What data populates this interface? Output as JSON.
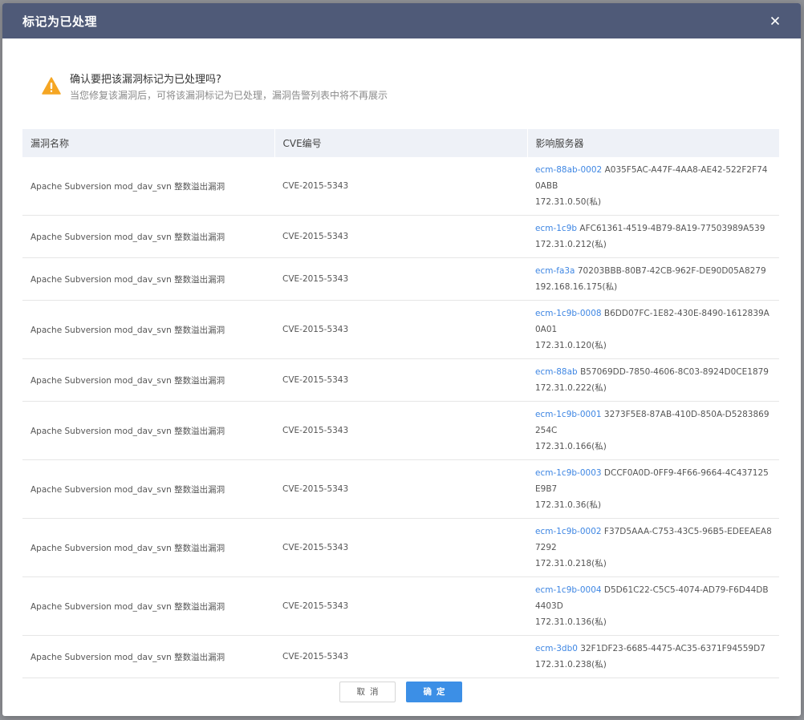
{
  "modal": {
    "title": "标记为已处理",
    "close_icon": "close-icon"
  },
  "notice": {
    "icon": "warning-triangle-icon",
    "icon_color": "#f5a623",
    "title": "确认要把该漏洞标记为已处理吗?",
    "description": "当您修复该漏洞后，可将该漏洞标记为已处理，漏洞告警列表中将不再展示"
  },
  "table": {
    "headers": [
      "漏洞名称",
      "CVE编号",
      "影响服务器"
    ],
    "rows": [
      {
        "name": "Apache Subversion mod_dav_svn 整数溢出漏洞",
        "cve": "CVE-2015-5343",
        "server_name": "ecm-88ab-0002",
        "server_id": "A035F5AC-A47F-4AA8-AE42-522F2F740ABB",
        "ip": "172.31.0.50(私)"
      },
      {
        "name": "Apache Subversion mod_dav_svn 整数溢出漏洞",
        "cve": "CVE-2015-5343",
        "server_name": "ecm-1c9b",
        "server_id": "AFC61361-4519-4B79-8A19-77503989A539",
        "ip": "172.31.0.212(私)"
      },
      {
        "name": "Apache Subversion mod_dav_svn 整数溢出漏洞",
        "cve": "CVE-2015-5343",
        "server_name": "ecm-fa3a",
        "server_id": "70203BBB-80B7-42CB-962F-DE90D05A8279",
        "ip": "192.168.16.175(私)"
      },
      {
        "name": "Apache Subversion mod_dav_svn 整数溢出漏洞",
        "cve": "CVE-2015-5343",
        "server_name": "ecm-1c9b-0008",
        "server_id": "B6DD07FC-1E82-430E-8490-1612839A0A01",
        "ip": "172.31.0.120(私)"
      },
      {
        "name": "Apache Subversion mod_dav_svn 整数溢出漏洞",
        "cve": "CVE-2015-5343",
        "server_name": "ecm-88ab",
        "server_id": "B57069DD-7850-4606-8C03-8924D0CE1879",
        "ip": "172.31.0.222(私)"
      },
      {
        "name": "Apache Subversion mod_dav_svn 整数溢出漏洞",
        "cve": "CVE-2015-5343",
        "server_name": "ecm-1c9b-0001",
        "server_id": "3273F5E8-87AB-410D-850A-D5283869254C",
        "ip": "172.31.0.166(私)"
      },
      {
        "name": "Apache Subversion mod_dav_svn 整数溢出漏洞",
        "cve": "CVE-2015-5343",
        "server_name": "ecm-1c9b-0003",
        "server_id": "DCCF0A0D-0FF9-4F66-9664-4C437125E9B7",
        "ip": "172.31.0.36(私)"
      },
      {
        "name": "Apache Subversion mod_dav_svn 整数溢出漏洞",
        "cve": "CVE-2015-5343",
        "server_name": "ecm-1c9b-0002",
        "server_id": "F37D5AAA-C753-43C5-96B5-EDEEAEA87292",
        "ip": "172.31.0.218(私)"
      },
      {
        "name": "Apache Subversion mod_dav_svn 整数溢出漏洞",
        "cve": "CVE-2015-5343",
        "server_name": "ecm-1c9b-0004",
        "server_id": "D5D61C22-C5C5-4074-AD79-F6D44DB4403D",
        "ip": "172.31.0.136(私)"
      },
      {
        "name": "Apache Subversion mod_dav_svn 整数溢出漏洞",
        "cve": "CVE-2015-5343",
        "server_name": "ecm-3db0",
        "server_id": "32F1DF23-6685-4475-AC35-6371F94559D7",
        "ip": "172.31.0.238(私)"
      }
    ]
  },
  "footer": {
    "cancel_label": "取消",
    "confirm_label": "确定"
  },
  "colors": {
    "header_bg": "#4f5a78",
    "link": "#3e86e3",
    "primary": "#3c8fe6"
  }
}
